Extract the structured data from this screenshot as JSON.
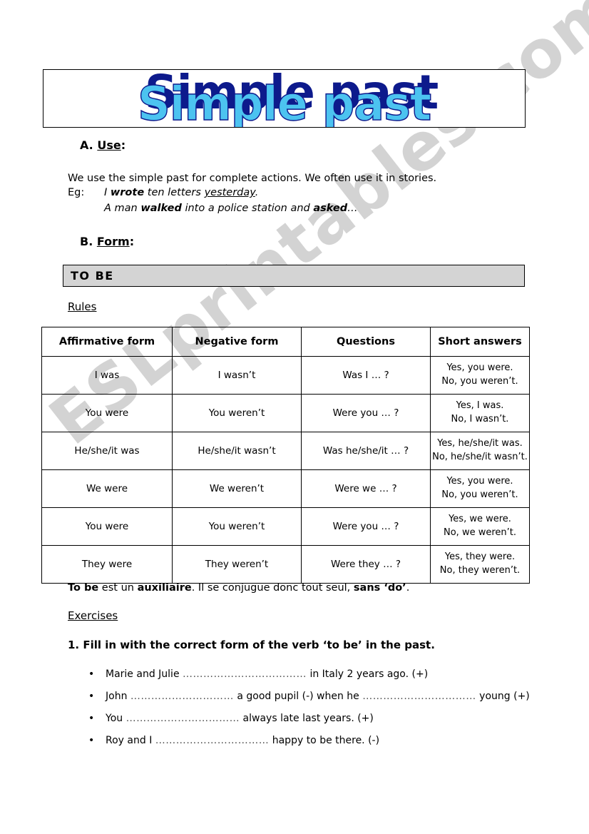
{
  "watermark": {
    "text": "ESLprintables.com"
  },
  "title": {
    "text": "Simple past"
  },
  "sections": {
    "use": {
      "heading_prefix": "A. ",
      "heading": "Use",
      "heading_suffix": ":",
      "paragraph": "We use the simple past for complete actions. We often use it in stories.",
      "eg_label": "Eg:",
      "example_1": {
        "pre": "I ",
        "verb": "wrote",
        "mid": " ten letters ",
        "underlined": "yesterday",
        "post": "."
      },
      "example_2": {
        "pre": "A man ",
        "verb": "walked",
        "mid": " into a police station and ",
        "verb2": "asked",
        "post": "…"
      }
    },
    "form": {
      "heading_prefix": "B. ",
      "heading": "Form",
      "heading_suffix": ":",
      "banner_label": "TO BE",
      "rules_label": "Rules"
    }
  },
  "table": {
    "headers": [
      "Affirmative form",
      "Negative form",
      "Questions",
      "Short answers"
    ],
    "rows": [
      {
        "affirmative": "I was",
        "negative": "I wasn’t",
        "question": "Was I … ?",
        "answer_yes": "Yes, you were.",
        "answer_no": "No, you weren’t."
      },
      {
        "affirmative": "You were",
        "negative": "You weren’t",
        "question": "Were you … ?",
        "answer_yes": "Yes, I was.",
        "answer_no": "No, I wasn’t."
      },
      {
        "affirmative": "He/she/it was",
        "negative": "He/she/it wasn’t",
        "question": "Was he/she/it … ?",
        "answer_yes": "Yes, he/she/it was.",
        "answer_no": "No, he/she/it wasn’t."
      },
      {
        "affirmative": "We were",
        "negative": "We weren’t",
        "question": "Were we … ?",
        "answer_yes": "Yes, you were.",
        "answer_no": "No, you weren’t."
      },
      {
        "affirmative": "You were",
        "negative": "You weren’t",
        "question": "Were you … ?",
        "answer_yes": "Yes, we were.",
        "answer_no": "No, we weren’t."
      },
      {
        "affirmative": "They were",
        "negative": "They weren’t",
        "question": "Were they … ?",
        "answer_yes": "Yes, they were.",
        "answer_no": "No, they weren’t."
      }
    ]
  },
  "note": {
    "bold_1": "To be",
    "plain_1": " est un ",
    "bold_2": "auxiliaire",
    "plain_2": ". Il se conjugue donc tout seul, ",
    "bold_3": "sans ‘do’",
    "plain_3": "."
  },
  "exercises": {
    "label": "Exercises",
    "instruction": "1. Fill in with the correct form of the verb ‘to be’ in the past.",
    "bullet_glyph": "•",
    "items": [
      {
        "pre": "Marie and Julie ",
        "blank": "………………………………",
        "post": " in Italy 2 years ago. (+)"
      },
      {
        "pre": "John  ",
        "blank": "…………………………",
        "post": "   a good pupil (-) when he ",
        "blank2": "……………………………",
        "post2": " young (+)"
      },
      {
        "pre": "You  ",
        "blank": "……………………………",
        "post": " always late last years. (+)"
      },
      {
        "pre": "Roy and I  ",
        "blank": "……………………………",
        "post": " happy to be there. (-)"
      }
    ]
  }
}
